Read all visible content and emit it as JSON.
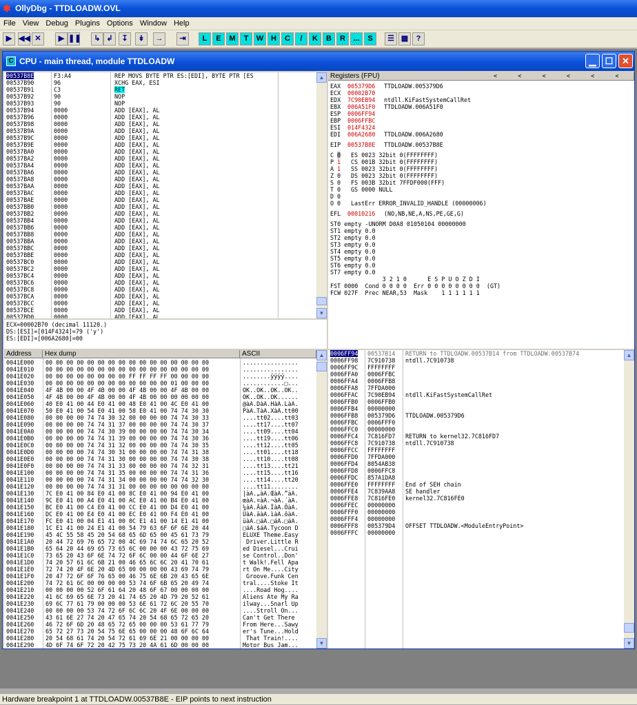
{
  "app": {
    "title": "OllyDbg - TTDLOADW.OVL"
  },
  "menu": [
    "File",
    "View",
    "Debug",
    "Plugins",
    "Options",
    "Window",
    "Help"
  ],
  "toolbar": {
    "nav": [
      "▶",
      "◀◀",
      "✕",
      "▶",
      "❚❚",
      "↳",
      "↲",
      "↧",
      "↡",
      "→",
      "⇥"
    ],
    "letters": [
      "L",
      "E",
      "M",
      "T",
      "W",
      "H",
      "C",
      "/",
      "K",
      "B",
      "R",
      "...",
      "S"
    ],
    "tail": [
      "☰",
      "▦",
      "?"
    ]
  },
  "cpu": {
    "title": "CPU - main thread, module TTDLOADW",
    "disasm": [
      [
        "00537B8E",
        "F3:A4",
        "REP MOVS BYTE PTR ES:[EDI], BYTE PTR [ES"
      ],
      [
        "00537B90",
        "96",
        "XCHG EAX, ESI"
      ],
      [
        "00537B91",
        "C3",
        "RET"
      ],
      [
        "00537B92",
        "90",
        "NOP"
      ],
      [
        "00537B93",
        "90",
        "NOP"
      ],
      [
        "00537B94",
        "0000",
        "ADD [EAX], AL"
      ],
      [
        "00537B96",
        "0000",
        "ADD [EAX], AL"
      ],
      [
        "00537B98",
        "0000",
        "ADD [EAX], AL"
      ],
      [
        "00537B9A",
        "0000",
        "ADD [EAX], AL"
      ],
      [
        "00537B9C",
        "0000",
        "ADD [EAX], AL"
      ],
      [
        "00537B9E",
        "0000",
        "ADD [EAX], AL"
      ],
      [
        "00537BA0",
        "0000",
        "ADD [EAX], AL"
      ],
      [
        "00537BA2",
        "0000",
        "ADD [EAX], AL"
      ],
      [
        "00537BA4",
        "0000",
        "ADD [EAX], AL"
      ],
      [
        "00537BA6",
        "0000",
        "ADD [EAX], AL"
      ],
      [
        "00537BA8",
        "0000",
        "ADD [EAX], AL"
      ],
      [
        "00537BAA",
        "0000",
        "ADD [EAX], AL"
      ],
      [
        "00537BAC",
        "0000",
        "ADD [EAX], AL"
      ],
      [
        "00537BAE",
        "0000",
        "ADD [EAX], AL"
      ],
      [
        "00537BB0",
        "0000",
        "ADD [EAX], AL"
      ],
      [
        "00537BB2",
        "0000",
        "ADD [EAX], AL"
      ],
      [
        "00537BB4",
        "0000",
        "ADD [EAX], AL"
      ],
      [
        "00537BB6",
        "0000",
        "ADD [EAX], AL"
      ],
      [
        "00537BB8",
        "0000",
        "ADD [EAX], AL"
      ],
      [
        "00537BBA",
        "0000",
        "ADD [EAX], AL"
      ],
      [
        "00537BBC",
        "0000",
        "ADD [EAX], AL"
      ],
      [
        "00537BBE",
        "0000",
        "ADD [EAX], AL"
      ],
      [
        "00537BC0",
        "0000",
        "ADD [EAX], AL"
      ],
      [
        "00537BC2",
        "0000",
        "ADD [EAX], AL"
      ],
      [
        "00537BC4",
        "0000",
        "ADD [EAX], AL"
      ],
      [
        "00537BC6",
        "0000",
        "ADD [EAX], AL"
      ],
      [
        "00537BC8",
        "0000",
        "ADD [EAX], AL"
      ],
      [
        "00537BCA",
        "0000",
        "ADD [EAX], AL"
      ],
      [
        "00537BCC",
        "0000",
        "ADD [EAX], AL"
      ],
      [
        "00537BCE",
        "0000",
        "ADD [EAX], AL"
      ],
      [
        "00537BD0",
        "0000",
        "ADD [EAX], AL"
      ]
    ],
    "info": [
      "ECX=00002B70 (decimal 11120.)",
      "DS:[ESI]=[014F4324]=79 ('y')",
      "ES:[EDI]=[006A2680]=00"
    ],
    "reg_header": "Registers (FPU)",
    "reg_arrows": "<      <      <      <      <      <      <",
    "regs": [
      [
        "EAX",
        "005379D6",
        "TTDLOADW.005379D6"
      ],
      [
        "ECX",
        "00002B70",
        ""
      ],
      [
        "EDX",
        "7C90EB94",
        "ntdll.KiFastSystemCallRet"
      ],
      [
        "EBX",
        "006A51F0",
        "TTDLOADW.006A51F0"
      ],
      [
        "ESP",
        "0006FF94",
        ""
      ],
      [
        "EBP",
        "0006FFBC",
        ""
      ],
      [
        "ESI",
        "014F4324",
        ""
      ],
      [
        "EDI",
        "006A2680",
        "TTDLOADW.006A2680"
      ]
    ],
    "eip": [
      "EIP",
      "00537B8E",
      "TTDLOADW.00537B8E"
    ],
    "flags": [
      [
        "C",
        "0",
        "ES 0023 32bit 0(FFFFFFFF)"
      ],
      [
        "P",
        "1",
        "CS 001B 32bit 0(FFFFFFFF)"
      ],
      [
        "A",
        "1",
        "SS 0023 32bit 0(FFFFFFFF)"
      ],
      [
        "Z",
        "0",
        "DS 0023 32bit 0(FFFFFFFF)"
      ],
      [
        "S",
        "0",
        "FS 003B 32bit 7FFDF000(FFF)"
      ],
      [
        "T",
        "0",
        "GS 0000 NULL"
      ],
      [
        "D",
        "0",
        ""
      ],
      [
        "O",
        "0",
        "LastErr ERROR_INVALID_HANDLE (00000006)"
      ]
    ],
    "efl": [
      "EFL",
      "00010216",
      "(NO,NB,NE,A,NS,PE,GE,G)"
    ],
    "fpu": [
      "ST0 empty -UNORM D0A8 01050104 00000000",
      "ST1 empty 0.0",
      "ST2 empty 0.0",
      "ST3 empty 0.0",
      "ST4 empty 0.0",
      "ST5 empty 0.0",
      "ST6 empty 0.0",
      "ST7 empty 0.0",
      "               3 2 1 0      E S P U O Z D I",
      "FST 0000  Cond 0 0 0 0  Err 0 0 0 0 0 0 0 0  (GT)",
      "FCW 027F  Prec NEAR,53  Mask    1 1 1 1 1 1"
    ],
    "dump_headers": [
      "Address",
      "Hex dump",
      "ASCII"
    ],
    "dump": [
      [
        "0041E000",
        "00 00 00 00 00 00 00 00 00 00 00 00 00 00 00 00",
        "................"
      ],
      [
        "0041E010",
        "00 00 00 00 00 00 00 00 00 00 00 00 00 00 00 00",
        "................"
      ],
      [
        "0041E020",
        "00 00 00 00 00 00 00 00 FF FF FF FF 00 00 00 00",
        "........ÿÿÿÿ...."
      ],
      [
        "0041E030",
        "00 00 00 00 00 00 00 00 00 00 00 00 01 00 00 00",
        "............□..."
      ],
      [
        "0041E040",
        "4F 4B 00 00 4F 4B 00 00 4F 4B 00 00 4F 4B 00 00",
        "OK..OK..OK..OK.."
      ],
      [
        "0041E050",
        "4F 4B 00 00 4F 4B 00 00 4F 4B 00 00 00 00 00 00",
        "OK..OK..OK......"
      ],
      [
        "0041E060",
        "40 E0 41 00 44 E0 41 00 48 E0 41 00 4C E0 41 00",
        "@àA.DàA.HàA.LàA."
      ],
      [
        "0041E070",
        "50 E0 41 00 54 E0 41 00 58 E0 41 00 74 74 30 30",
        "PàA.TàA.XàA.tt00"
      ],
      [
        "0041E080",
        "00 00 00 00 74 74 30 32 00 00 00 00 74 74 30 33",
        "....tt02....tt03"
      ],
      [
        "0041E090",
        "00 00 00 00 74 74 31 37 00 00 00 00 74 74 30 37",
        "....tt17....tt07"
      ],
      [
        "0041E0A0",
        "00 00 00 00 74 74 30 39 00 00 00 00 74 74 30 34",
        "....tt09....tt04"
      ],
      [
        "0041E0B0",
        "00 00 00 00 74 74 31 39 00 00 00 00 74 74 30 36",
        "....tt19....tt06"
      ],
      [
        "0041E0C0",
        "00 00 00 00 74 74 31 32 00 00 00 00 74 74 30 35",
        "....tt12....tt05"
      ],
      [
        "0041E0D0",
        "00 00 00 00 74 74 30 31 00 00 00 00 74 74 31 38",
        "....tt01....tt18"
      ],
      [
        "0041E0E0",
        "00 00 00 00 74 74 31 30 00 00 00 00 74 74 30 38",
        "....tt10....tt08"
      ],
      [
        "0041E0F0",
        "00 00 00 00 74 74 31 33 00 00 00 00 74 74 32 31",
        "....tt13....tt21"
      ],
      [
        "0041E100",
        "00 00 00 00 74 74 31 35 00 00 00 00 74 74 31 36",
        "....tt15....tt16"
      ],
      [
        "0041E110",
        "00 00 00 00 74 74 31 34 00 00 00 00 74 74 32 30",
        "....tt14....tt20"
      ],
      [
        "0041E120",
        "00 00 00 00 74 74 31 31 00 00 00 00 00 00 00 00",
        "....tt11........"
      ],
      [
        "0041E130",
        "7C E0 41 00 84 E0 41 00 8C E0 41 00 94 E0 41 00",
        "|àA.„àA.ŒàA.”àA."
      ],
      [
        "0041E140",
        "9C E0 41 00 A4 E0 41 00 AC E0 41 00 B4 E0 41 00",
        "œàA.¤àA.¬àA.´àA."
      ],
      [
        "0041E150",
        "BC E0 41 00 C4 E0 41 00 CC E0 41 00 D4 E0 41 00",
        "¼àA.ÄàA.ÌàA.ÔàA."
      ],
      [
        "0041E160",
        "DC E0 41 00 E4 E0 41 00 EC E0 41 00 F4 E0 41 00",
        "ÜàA.äàA.ìàA.ôàA."
      ],
      [
        "0041E170",
        "FC E0 41 00 04 E1 41 00 0C E1 41 00 14 E1 41 00",
        "üàA.□áA.□áA.□áA."
      ],
      [
        "0041E180",
        "1C E1 41 00 24 E1 41 00 54 79 63 6F 6F 6E 20 44",
        "□áA.$áA.Tycoon D"
      ],
      [
        "0041E190",
        "45 4C 55 58 45 20 54 68 65 6D 65 00 45 61 73 79",
        "ELUXE Theme.Easy"
      ],
      [
        "0041E1A0",
        "20 44 72 69 76 65 72 00 4C 69 74 74 6C 65 20 52",
        " Driver.Little R"
      ],
      [
        "0041E1B0",
        "65 64 20 44 69 65 73 65 6C 00 00 00 43 72 75 69",
        "ed Diesel...Crui"
      ],
      [
        "0041E1C0",
        "73 65 20 43 6F 6E 74 72 6F 6C 00 00 44 6F 6E 27",
        "se Control..Don'"
      ],
      [
        "0041E1D0",
        "74 20 57 61 6C 6B 21 00 46 65 6C 6C 20 41 70 61",
        "t Walk!.Fell Apa"
      ],
      [
        "0041E1E0",
        "72 74 20 4F 6E 20 4D 65 00 00 00 00 43 69 74 79",
        "rt On Me....City"
      ],
      [
        "0041E1F0",
        "20 47 72 6F 6F 76 65 00 46 75 6E 6B 20 43 65 6E",
        " Groove.Funk Cen"
      ],
      [
        "0041E200",
        "74 72 61 6C 00 00 00 00 53 74 6F 6B 65 20 49 74",
        "tral....Stoke It"
      ],
      [
        "0041E210",
        "00 00 00 00 52 6F 61 64 20 48 6F 67 00 00 00 00",
        "....Road Hog...."
      ],
      [
        "0041E220",
        "41 6C 69 65 6E 73 20 41 74 65 20 4D 79 20 52 61",
        "Aliens Ate My Ra"
      ],
      [
        "0041E230",
        "69 6C 77 61 79 00 00 00 53 6E 61 72 6C 20 55 70",
        "ilway...Snarl Up"
      ],
      [
        "0041E240",
        "00 00 00 00 53 74 72 6F 6C 6C 20 4F 6E 00 00 00",
        "....Stroll On..."
      ],
      [
        "0041E250",
        "43 61 6E 27 74 20 47 65 74 20 54 68 65 72 65 20",
        "Can't Get There "
      ],
      [
        "0041E260",
        "46 72 6F 6D 20 48 65 72 65 00 00 00 53 61 77 79",
        "From Here...Sawy"
      ],
      [
        "0041E270",
        "65 72 27 73 20 54 75 6E 65 00 00 00 48 6F 6C 64",
        "er's Tune...Hold"
      ],
      [
        "0041E280",
        "20 54 68 61 74 20 54 72 61 69 6E 21 00 00 00 00",
        " That Train!...."
      ],
      [
        "0041E290",
        "4D 6F 74 6F 72 20 42 75 73 20 4A 61 6D 00 00 00",
        "Motor Bus Jam..."
      ]
    ],
    "stack": [
      [
        "0006FF94",
        "00537B14",
        "RETURN to TTDLOADW.00537B14 from TTDLOADW.00537B74"
      ],
      [
        "0006FF98",
        "7C910738",
        "ntdll.7C910738"
      ],
      [
        "0006FF9C",
        "FFFFFFFF",
        ""
      ],
      [
        "0006FFA0",
        "0006FFBC",
        ""
      ],
      [
        "0006FFA4",
        "0006FFB8",
        ""
      ],
      [
        "0006FFA8",
        "7FFDA000",
        ""
      ],
      [
        "0006FFAC",
        "7C90EB94",
        "ntdll.KiFastSystemCallRet"
      ],
      [
        "0006FFB0",
        "0006FFB0",
        ""
      ],
      [
        "0006FFB4",
        "00000000",
        ""
      ],
      [
        "0006FFB8",
        "005379D6",
        "TTDLOADW.005379D6"
      ],
      [
        "0006FFBC",
        "0006FFF0",
        ""
      ],
      [
        "0006FFC0",
        "00000000",
        ""
      ],
      [
        "0006FFC4",
        "7C816FD7",
        "RETURN to kernel32.7C816FD7"
      ],
      [
        "0006FFC8",
        "7C910738",
        "ntdll.7C910738"
      ],
      [
        "0006FFCC",
        "FFFFFFFF",
        ""
      ],
      [
        "0006FFD0",
        "7FFDA000",
        ""
      ],
      [
        "0006FFD4",
        "8054AB38",
        ""
      ],
      [
        "0006FFD8",
        "0006FFC8",
        ""
      ],
      [
        "0006FFDC",
        "857A1DA8",
        ""
      ],
      [
        "0006FFE0",
        "FFFFFFFF",
        "End of SEH chain"
      ],
      [
        "0006FFE4",
        "7C839AA8",
        "SE handler"
      ],
      [
        "0006FFE8",
        "7C816FE0",
        "kernel32.7C816FE0"
      ],
      [
        "0006FFEC",
        "00000000",
        ""
      ],
      [
        "0006FFF0",
        "00000000",
        ""
      ],
      [
        "0006FFF4",
        "00000000",
        ""
      ],
      [
        "0006FFF8",
        "005379D4",
        "OFFSET TTDLOADW.<ModuleEntryPoint>"
      ],
      [
        "0006FFFC",
        "00000000",
        ""
      ]
    ]
  },
  "status": "Hardware breakpoint 1 at TTDLOADW.00537B8E - EIP points to next instruction"
}
